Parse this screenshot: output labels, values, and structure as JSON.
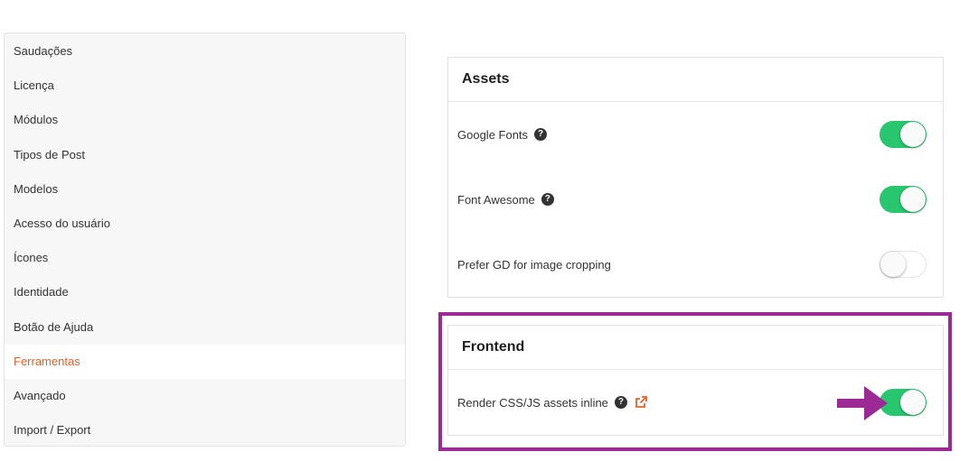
{
  "sidebar": {
    "items": [
      {
        "label": "Saudações"
      },
      {
        "label": "Licença"
      },
      {
        "label": "Módulos"
      },
      {
        "label": "Tipos de Post"
      },
      {
        "label": "Modelos"
      },
      {
        "label": "Acesso do usuário"
      },
      {
        "label": "Ícones"
      },
      {
        "label": "Identidade"
      },
      {
        "label": "Botão de Ajuda"
      },
      {
        "label": "Ferramentas",
        "active": true
      },
      {
        "label": "Avançado"
      },
      {
        "label": "Import / Export"
      }
    ],
    "active_color": "#e8602c"
  },
  "assets": {
    "title": "Assets",
    "rows": [
      {
        "label": "Google Fonts",
        "help_icon": "question-circle-icon",
        "enabled": true
      },
      {
        "label": "Font Awesome",
        "help_icon": "question-circle-icon",
        "enabled": true
      },
      {
        "label": "Prefer GD for image cropping",
        "enabled": false
      }
    ]
  },
  "frontend": {
    "title": "Frontend",
    "rows": [
      {
        "label": "Render CSS/JS assets inline",
        "help_icon": "question-circle-icon",
        "link_icon": "external-link-icon",
        "enabled": true
      }
    ]
  },
  "colors": {
    "toggle_on": "#28c76f",
    "highlight": "#9b2a94",
    "external_link": "#e8602c"
  },
  "annotation": {
    "arrow_icon": "arrow-right-icon"
  }
}
